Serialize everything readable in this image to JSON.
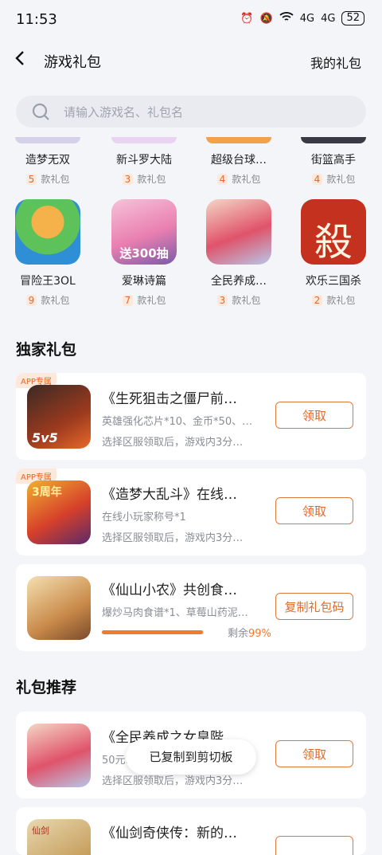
{
  "status": {
    "time": "11:53",
    "battery": "52",
    "network": "4G"
  },
  "header": {
    "title": "游戏礼包",
    "my_gifts": "我的礼包"
  },
  "search": {
    "placeholder": "请输入游戏名、礼包名"
  },
  "unit": "款礼包",
  "games_row1": [
    {
      "name": "造梦无双",
      "count": "5"
    },
    {
      "name": "新斗罗大陆",
      "count": "3"
    },
    {
      "name": "超级台球…",
      "count": "4"
    },
    {
      "name": "街篮高手",
      "count": "4"
    }
  ],
  "games_row2": [
    {
      "name": "冒险王3OL",
      "count": "9",
      "icon_text": ""
    },
    {
      "name": "爱琳诗篇",
      "count": "7",
      "icon_text": "送300抽"
    },
    {
      "name": "全民养成…",
      "count": "3",
      "icon_text": ""
    },
    {
      "name": "欢乐三国杀",
      "count": "2",
      "icon_text": "殺"
    }
  ],
  "exclusive": {
    "title": "独家礼包",
    "app_tag": "APP专属",
    "cards": [
      {
        "title": "《生死狙击之僵尸前…",
        "line1": "英雄强化芯片*10、金币*50、…",
        "line2": "选择区服领取后，游戏内3分…",
        "button": "领取",
        "icon_text": "5v5"
      },
      {
        "title": "《造梦大乱斗》在线…",
        "line1": "在线小玩家称号*1",
        "line2": "选择区服领取后，游戏内3分…",
        "button": "领取",
        "icon_text": "3周年"
      },
      {
        "title": "《仙山小农》共创食…",
        "line1": "爆炒马肉食谱*1、草莓山药泥…",
        "button": "复制礼包码",
        "remaining_label": "剩余",
        "remaining": "99%",
        "progress": 0.99
      }
    ]
  },
  "recommend": {
    "title": "礼包推荐",
    "cards": [
      {
        "title": "《全民养成之女皇陛…",
        "line1": "50元…",
        "line2": "选择区服领取后，游戏内3分…",
        "button": "领取"
      },
      {
        "title": "《仙剑奇侠传：新的…",
        "icon_text": "仙剑"
      }
    ]
  },
  "toast": "已复制到剪切板"
}
